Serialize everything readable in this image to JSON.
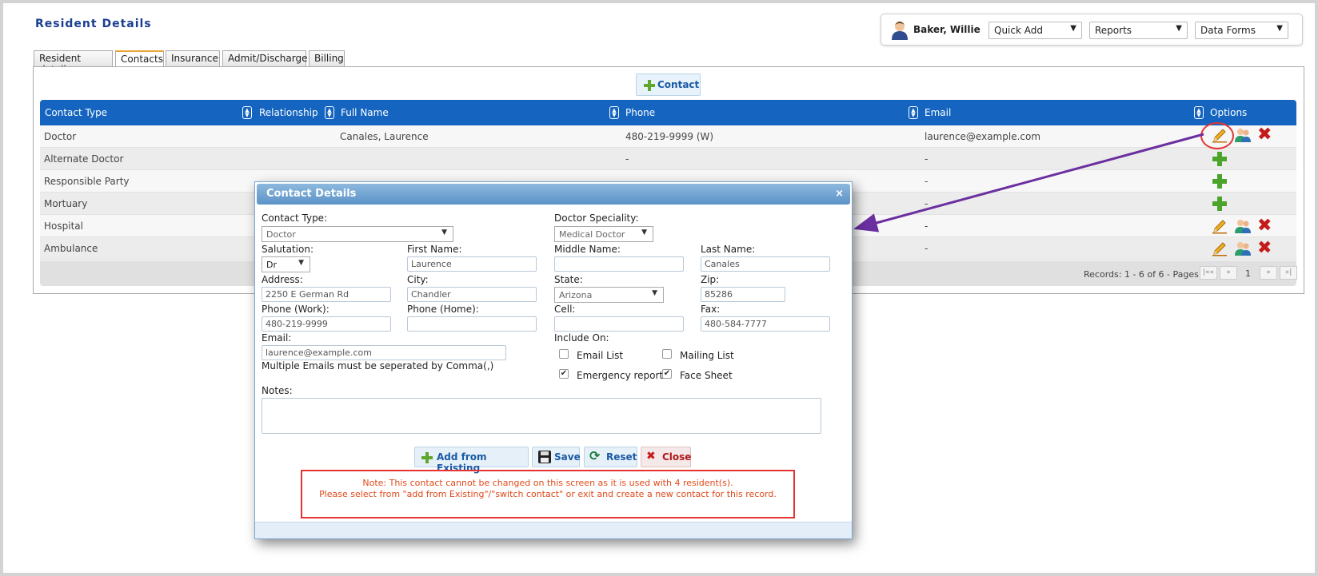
{
  "header": {
    "title": "Resident Details"
  },
  "user": {
    "name": "Baker, Willie"
  },
  "dropdowns": {
    "quick_add": "Quick Add",
    "reports": "Reports",
    "data_forms": "Data Forms"
  },
  "tabs": [
    "Resident details",
    "Contacts",
    "Insurance",
    "Admit/Discharge",
    "Billing"
  ],
  "active_tab": "Contacts",
  "contact_button": "Contact",
  "grid": {
    "columns": [
      "Contact Type",
      "Relationship",
      "Full Name",
      "Phone",
      "Email",
      "Options"
    ],
    "rows": [
      {
        "type": "Doctor",
        "relationship": "",
        "name": "Canales, Laurence",
        "phone": "480-219-9999 (W)",
        "email": "laurence@example.com"
      },
      {
        "type": "Alternate Doctor",
        "relationship": "",
        "name": "",
        "phone": "-",
        "email": "-"
      },
      {
        "type": "Responsible Party",
        "relationship": "",
        "name": "",
        "phone": "",
        "email": "-"
      },
      {
        "type": "Mortuary",
        "relationship": "",
        "name": "",
        "phone": "",
        "email": "-"
      },
      {
        "type": "Hospital",
        "relationship": "",
        "name": "",
        "phone": "",
        "email": "-"
      },
      {
        "type": "Ambulance",
        "relationship": "",
        "name": "",
        "phone": "",
        "email": "-"
      }
    ],
    "footer": {
      "records": "Records: 1 - 6 of 6 - Pages:",
      "page": "1"
    }
  },
  "modal": {
    "title": "Contact Details",
    "close_glyph": "×",
    "labels": {
      "contact_type": "Contact Type:",
      "doctor_speciality": "Doctor Speciality:",
      "salutation": "Salutation:",
      "first_name": "First Name:",
      "middle_name": "Middle Name:",
      "last_name": "Last Name:",
      "address": "Address:",
      "city": "City:",
      "state": "State:",
      "zip": "Zip:",
      "phone_work": "Phone (Work):",
      "phone_home": "Phone (Home):",
      "cell": "Cell:",
      "fax": "Fax:",
      "email": "Email:",
      "email_hint": "Multiple Emails must be seperated by Comma(,)",
      "include_on": "Include On:",
      "email_list": "Email List",
      "mailing_list": "Mailing List",
      "emergency_report": "Emergency report",
      "face_sheet": "Face Sheet",
      "notes": "Notes:"
    },
    "values": {
      "contact_type": "Doctor",
      "doctor_speciality": "Medical Doctor",
      "salutation": "Dr",
      "first_name": "Laurence",
      "middle_name": "",
      "last_name": "Canales",
      "address": "2250 E German Rd",
      "city": "Chandler",
      "state": "Arizona",
      "zip": "85286",
      "phone_work": "480-219-9999",
      "phone_home": "",
      "cell": "",
      "fax": "480-584-7777",
      "email": "laurence@example.com"
    },
    "checks": {
      "email_list": false,
      "mailing_list": false,
      "emergency_report": true,
      "face_sheet": true
    },
    "buttons": {
      "add_existing": "Add from Existing",
      "save": "Save",
      "reset": "Reset",
      "close": "Close"
    },
    "note_line1": "Note: This contact cannot be changed on this screen as it is used with 4 resident(s).",
    "note_line2": "Please select from \"add from Existing\"/\"switch contact\" or exit and create a new contact for this record."
  },
  "colors": {
    "header_blue": "#1565c0",
    "note_red": "#e53333",
    "arrow_purple": "#6b2fa0"
  }
}
